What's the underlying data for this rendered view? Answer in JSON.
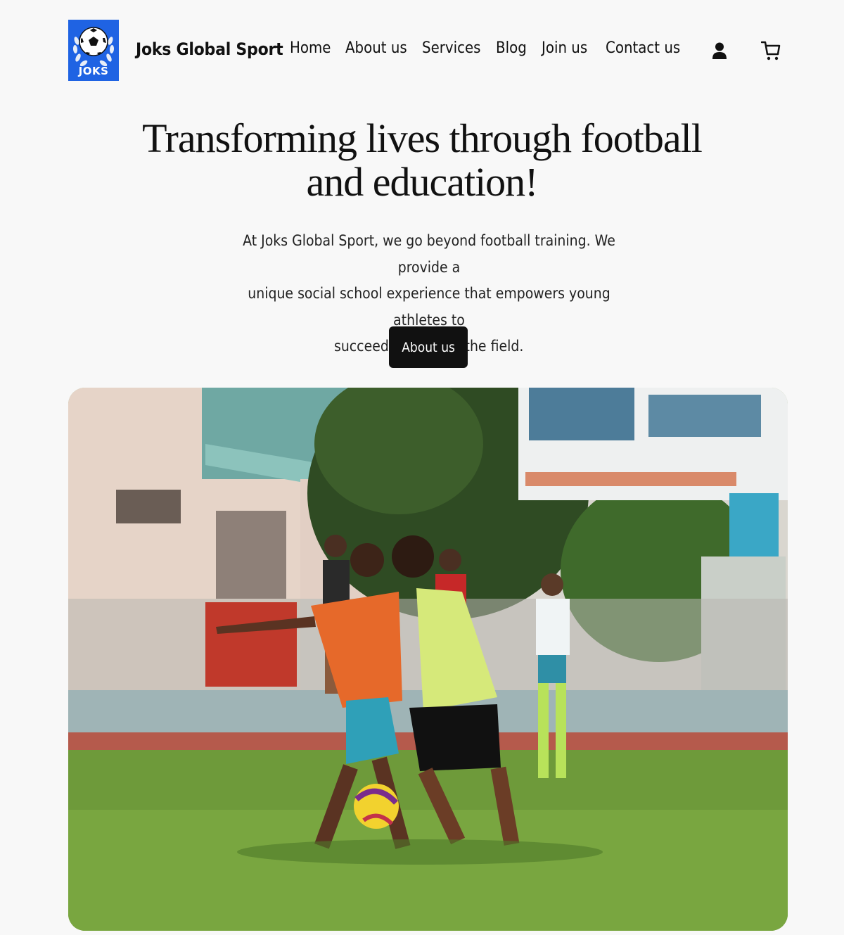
{
  "header": {
    "logo_text": "JOKS",
    "brand": "Joks Global Sport",
    "nav": [
      {
        "label": "Home"
      },
      {
        "label": "About us"
      },
      {
        "label": "Services"
      },
      {
        "label": "Blog"
      },
      {
        "label": "Join us"
      },
      {
        "label": "Contact us"
      }
    ],
    "icons": [
      "account-icon",
      "cart-icon"
    ]
  },
  "hero": {
    "title_line1": "Transforming lives through football",
    "title_line2": "and education!",
    "text_line1": "At Joks Global Sport, we go beyond football training. We provide a",
    "text_line2": "unique social school experience that empowers young athletes to",
    "text_line3": "succeed on and off the field.",
    "cta_label": "About us"
  },
  "colors": {
    "background": "#f8f8f8",
    "logo_blue": "#1f63e3",
    "button": "#111111",
    "text": "#111111"
  }
}
